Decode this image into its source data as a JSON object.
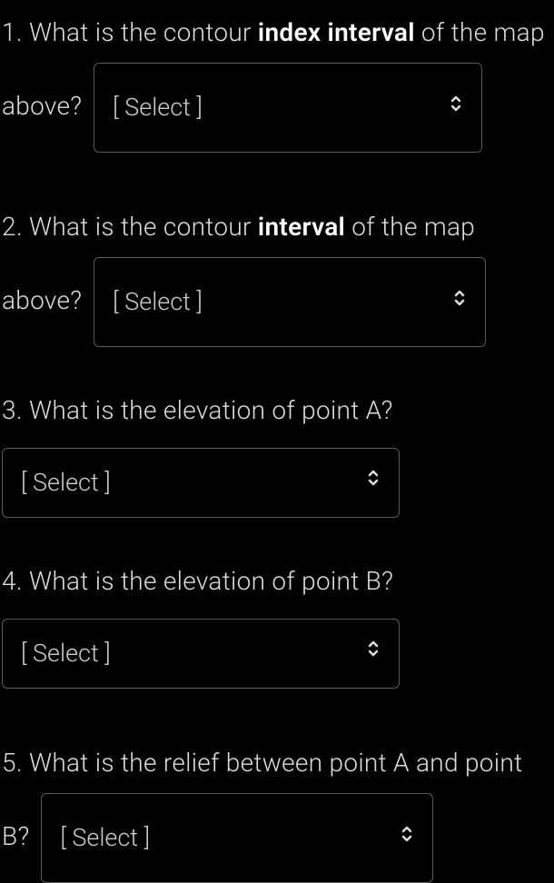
{
  "questions": {
    "q1": {
      "prefix": "1. What is the contour ",
      "bold": "index interval",
      "suffix": " of the map above?",
      "select": "[ Select ]"
    },
    "q2": {
      "prefix": "2. What is the contour ",
      "bold": "interval",
      "suffix": " of the map above?",
      "select": "[ Select ]"
    },
    "q3": {
      "text": "3. What is the elevation of point A?",
      "select": "[ Select ]"
    },
    "q4": {
      "text": "4. What is the elevation of point B?",
      "select": "[ Select ]"
    },
    "q5": {
      "prefix": "5. What is the relief between point A and point B?",
      "select": "[ Select ]"
    }
  }
}
